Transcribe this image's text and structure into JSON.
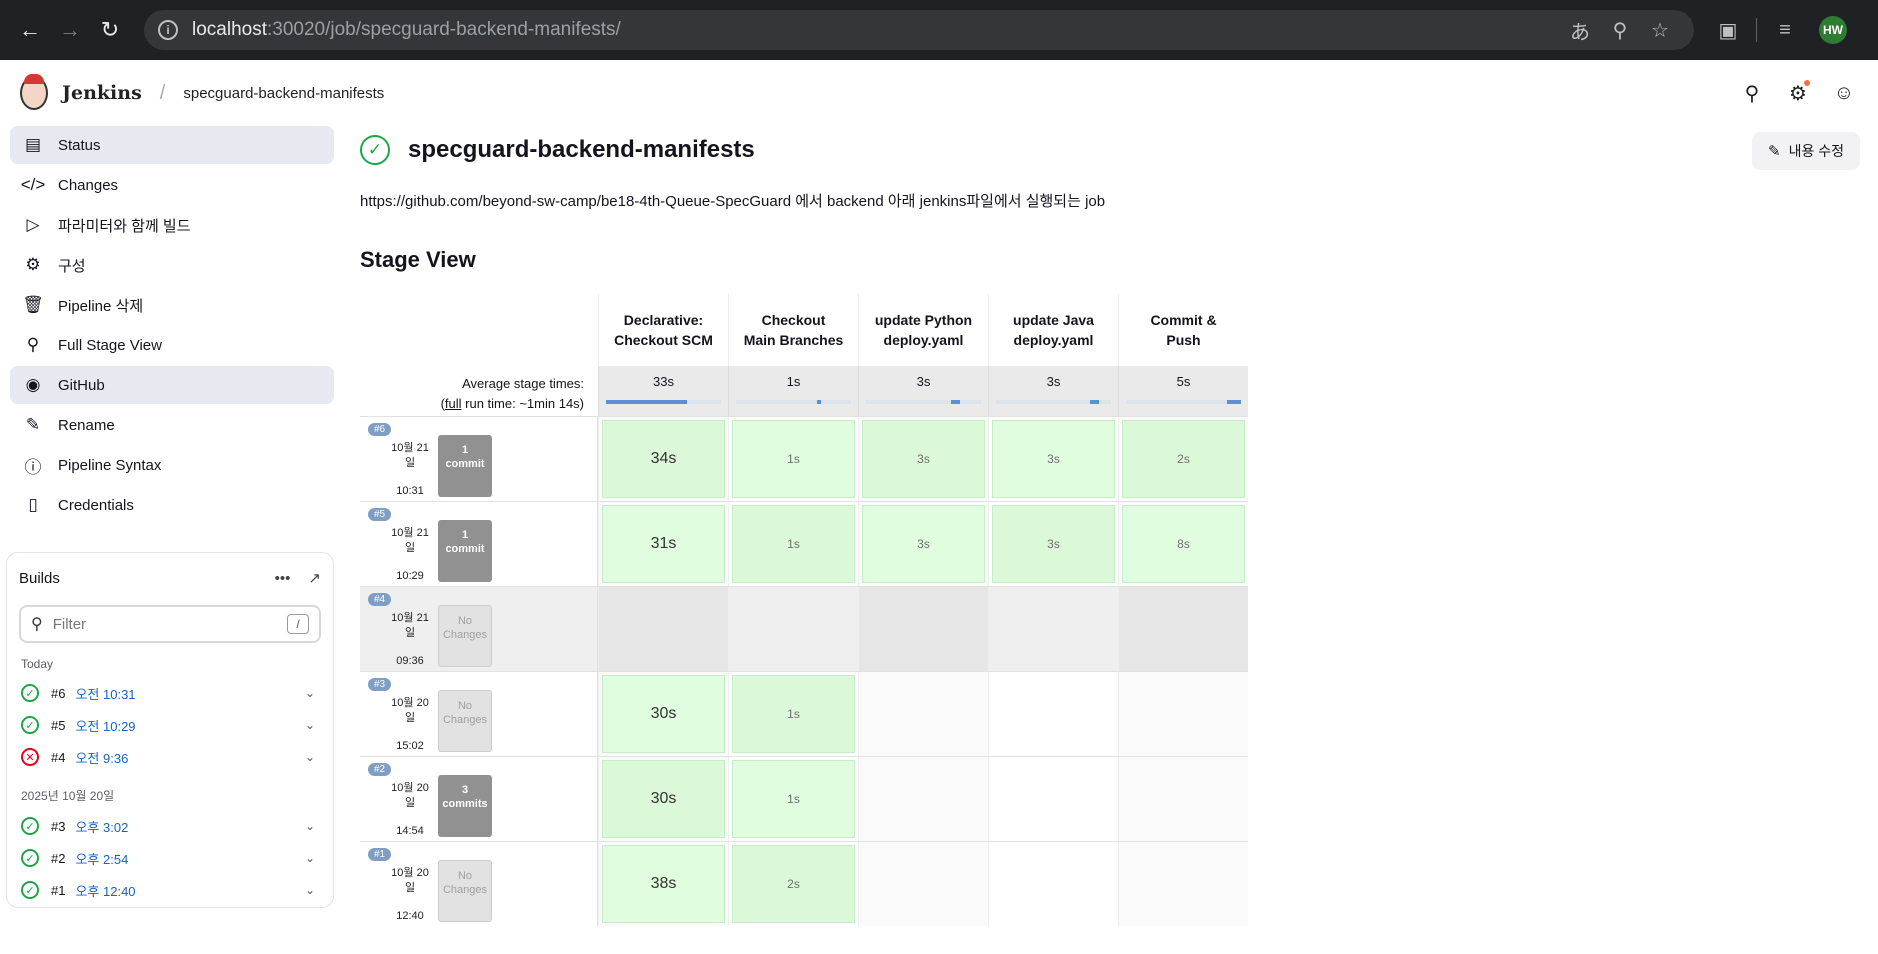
{
  "browser": {
    "url_host": "localhost",
    "url_path": ":30020/job/specguard-backend-manifests/",
    "profile_initials": "HW"
  },
  "header": {
    "brand": "Jenkins",
    "breadcrumb": "specguard-backend-manifests"
  },
  "sidebar": {
    "items": [
      {
        "label": "Status",
        "icon": "notepad-icon"
      },
      {
        "label": "Changes",
        "icon": "code-icon"
      },
      {
        "label": "파라미터와 함께 빌드",
        "icon": "play-icon"
      },
      {
        "label": "구성",
        "icon": "gear-icon"
      },
      {
        "label": "Pipeline 삭제",
        "icon": "trash-icon"
      },
      {
        "label": "Full Stage View",
        "icon": "search-icon"
      },
      {
        "label": "GitHub",
        "icon": "github-icon"
      },
      {
        "label": "Rename",
        "icon": "pencil-icon"
      },
      {
        "label": "Pipeline Syntax",
        "icon": "help-icon"
      },
      {
        "label": "Credentials",
        "icon": "phone-icon"
      }
    ]
  },
  "builds": {
    "title": "Builds",
    "filter_placeholder": "Filter",
    "filter_shortcut": "/",
    "groups": [
      {
        "label": "Today",
        "rows": [
          {
            "num": "#6",
            "time": "오전 10:31",
            "status": "success"
          },
          {
            "num": "#5",
            "time": "오전 10:29",
            "status": "success"
          },
          {
            "num": "#4",
            "time": "오전 9:36",
            "status": "failed"
          }
        ]
      },
      {
        "label": "2025년 10월 20일",
        "rows": [
          {
            "num": "#3",
            "time": "오후 3:02",
            "status": "success"
          },
          {
            "num": "#2",
            "time": "오후 2:54",
            "status": "success"
          },
          {
            "num": "#1",
            "time": "오후 12:40",
            "status": "success"
          }
        ]
      }
    ]
  },
  "main": {
    "title": "specguard-backend-manifests",
    "edit_label": "내용 수정",
    "description": "https://github.com/beyond-sw-camp/be18-4th-Queue-SpecGuard 에서 backend 아래 jenkins파일에서 실행되는 job",
    "stage_view_heading": "Stage View"
  },
  "stage_view": {
    "avg_label_line1": "Average stage times:",
    "avg_label_full": "full",
    "avg_label_rest": " run time: ~1min 14s)",
    "stages": [
      {
        "name_line1": "Declarative:",
        "name_line2": "Checkout SCM",
        "avg": "33s",
        "avg_fraction": 0.7
      },
      {
        "name_line1": "Checkout",
        "name_line2": "Main Branches",
        "avg": "1s",
        "avg_fraction": 0.04
      },
      {
        "name_line1": "update Python",
        "name_line2": "deploy.yaml",
        "avg": "3s",
        "avg_fraction": 0.08
      },
      {
        "name_line1": "update Java",
        "name_line2": "deploy.yaml",
        "avg": "3s",
        "avg_fraction": 0.08
      },
      {
        "name_line1": "Commit &",
        "name_line2": "Push",
        "avg": "5s",
        "avg_fraction": 0.12
      }
    ],
    "runs": [
      {
        "badge": "#6",
        "date_line1": "10월 21",
        "date_line2": "일",
        "time": "10:31",
        "changes_line1": "1",
        "changes_line2": "commit",
        "has_changes": true,
        "failed": false,
        "durations": [
          "34s",
          "1s",
          "3s",
          "3s",
          "2s"
        ]
      },
      {
        "badge": "#5",
        "date_line1": "10월 21",
        "date_line2": "일",
        "time": "10:29",
        "changes_line1": "1",
        "changes_line2": "commit",
        "has_changes": true,
        "failed": false,
        "durations": [
          "31s",
          "1s",
          "3s",
          "3s",
          "8s"
        ]
      },
      {
        "badge": "#4",
        "date_line1": "10월 21",
        "date_line2": "일",
        "time": "09:36",
        "changes_line1": "No",
        "changes_line2": "Changes",
        "has_changes": false,
        "failed": true,
        "durations": [
          "",
          "",
          "",
          "",
          ""
        ]
      },
      {
        "badge": "#3",
        "date_line1": "10월 20",
        "date_line2": "일",
        "time": "15:02",
        "changes_line1": "No",
        "changes_line2": "Changes",
        "has_changes": false,
        "failed": false,
        "durations": [
          "30s",
          "1s",
          "",
          "",
          ""
        ]
      },
      {
        "badge": "#2",
        "date_line1": "10월 20",
        "date_line2": "일",
        "time": "14:54",
        "changes_line1": "3",
        "changes_line2": "commits",
        "has_changes": true,
        "failed": false,
        "durations": [
          "30s",
          "1s",
          "",
          "",
          ""
        ]
      },
      {
        "badge": "#1",
        "date_line1": "10월 20",
        "date_line2": "일",
        "time": "12:40",
        "changes_line1": "No",
        "changes_line2": "Changes",
        "has_changes": false,
        "failed": false,
        "durations": [
          "38s",
          "2s",
          "",
          "",
          ""
        ]
      }
    ]
  },
  "colors": {
    "success": "#1ea64b",
    "failure": "#e6001f",
    "stage_success": "#e0fde0",
    "link": "#1564c0"
  }
}
